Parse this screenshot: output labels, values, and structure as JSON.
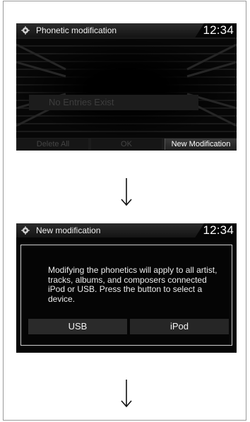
{
  "screen1": {
    "title": "Phonetic modification",
    "clock": "12:34",
    "empty_message": "No Entries Exist",
    "softkeys": {
      "delete_all": "Delete All",
      "ok": "OK",
      "new_modification": "New Modification"
    }
  },
  "screen2": {
    "title": "New modification",
    "clock": "12:34",
    "message": "Modifying the phonetics will apply to all artist, tracks, albums, and composers connected iPod or USB. Press the button to select a device.",
    "buttons": {
      "usb": "USB",
      "ipod": "iPod"
    }
  },
  "icons": {
    "settings": "gear-icon",
    "arrow": "down-arrow-icon"
  },
  "colors": {
    "screen_bg": "#050505",
    "text": "#e8e8e8",
    "disabled_text": "#444444"
  }
}
